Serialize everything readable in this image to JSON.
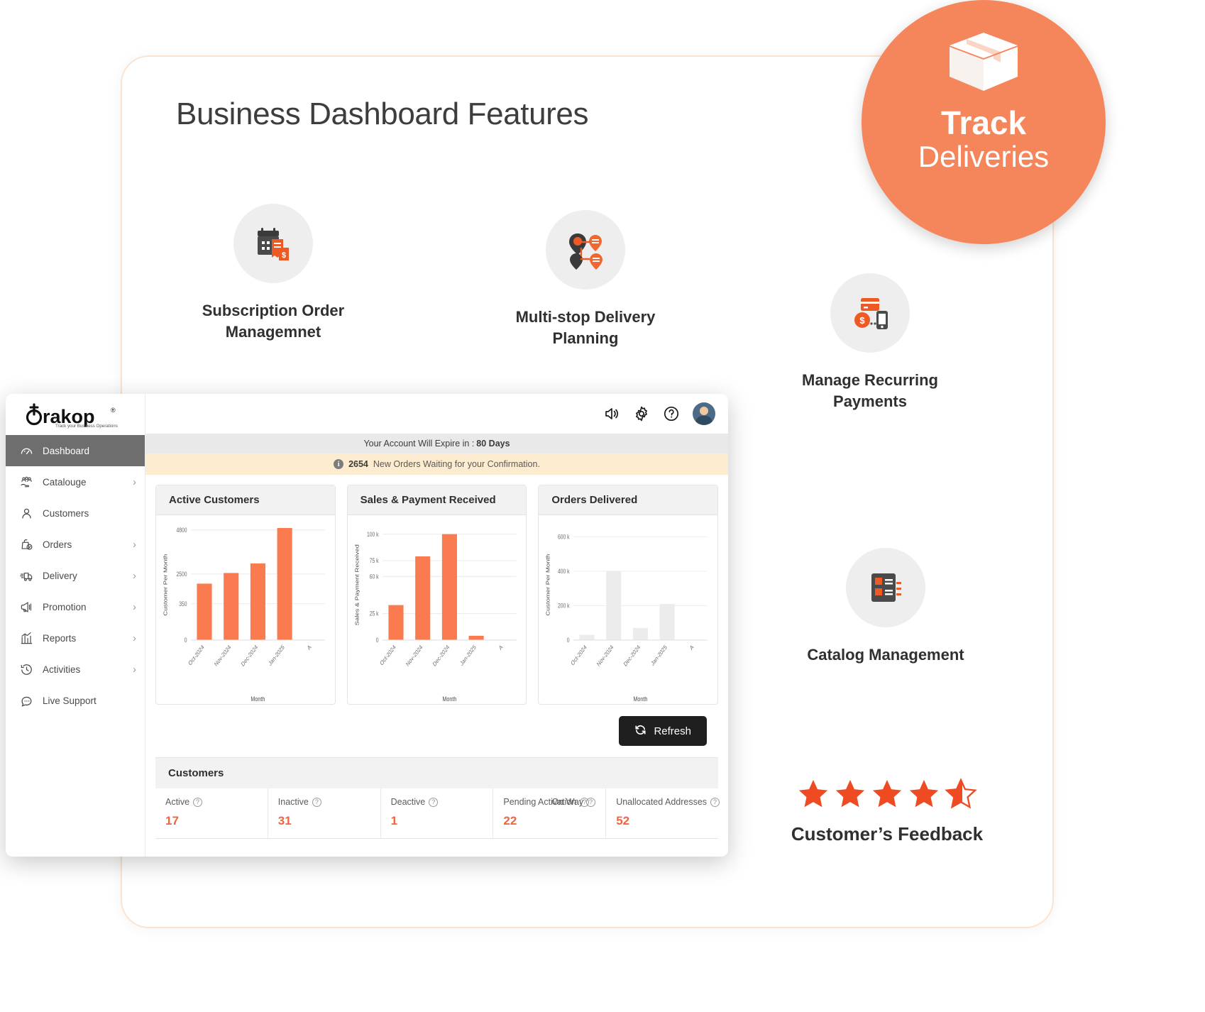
{
  "page": {
    "title": "Business Dashboard Features"
  },
  "badge": {
    "icon": "package-box-icon",
    "line1": "Track",
    "line2": "Deliveries",
    "color": "#f5855a"
  },
  "features": [
    {
      "icon": "calendar-invoice-icon",
      "label": "Subscription Order Managemnet"
    },
    {
      "icon": "route-map-pin-icon",
      "label": "Multi-stop Delivery Planning"
    },
    {
      "icon": "recurring-payment-icon",
      "label": "Manage Recurring Payments"
    },
    {
      "icon": "catalog-list-icon",
      "label": "Catalog Management"
    }
  ],
  "feedback": {
    "label": "Customer’s Feedback",
    "rating": 4.5,
    "star_count": 5,
    "star_color": "#ef4b23"
  },
  "dashboard": {
    "brand": {
      "name": "trakop",
      "registered": "®",
      "tagline": "Track your Business Operations"
    },
    "sidebar": {
      "items": [
        {
          "label": "Dashboard",
          "icon": "gauge-icon",
          "active": true,
          "chevron": false
        },
        {
          "label": "Catalouge",
          "icon": "catalogue-icon",
          "active": false,
          "chevron": true
        },
        {
          "label": "Customers",
          "icon": "user-icon",
          "active": false,
          "chevron": false
        },
        {
          "label": "Orders",
          "icon": "bag-check-icon",
          "active": false,
          "chevron": true
        },
        {
          "label": "Delivery",
          "icon": "truck-icon",
          "active": false,
          "chevron": true
        },
        {
          "label": "Promotion",
          "icon": "megaphone-icon",
          "active": false,
          "chevron": true
        },
        {
          "label": "Reports",
          "icon": "bar-chart-icon",
          "active": false,
          "chevron": true
        },
        {
          "label": "Activities",
          "icon": "history-icon",
          "active": false,
          "chevron": true
        },
        {
          "label": "Live Support",
          "icon": "chat-icon",
          "active": false,
          "chevron": false
        }
      ]
    },
    "topbar": {
      "icons": [
        "speaker-icon",
        "gear-icon",
        "help-icon"
      ],
      "avatar": "user-avatar"
    },
    "expiry_bar": {
      "text": "Your Account Will Expire in :",
      "value": "80 Days"
    },
    "orders_bar": {
      "icon": "info-icon",
      "count": "2654",
      "text": "New Orders Waiting for your Confirmation."
    },
    "refresh_button": {
      "label": "Refresh",
      "icon": "refresh-icon"
    },
    "customers_panel": {
      "title": "Customers",
      "stats": [
        {
          "label": "Active",
          "value": "17",
          "help": true
        },
        {
          "label": "Inactive",
          "value": "31",
          "help": true
        },
        {
          "label": "Deactive",
          "value": "1",
          "help": true
        },
        {
          "label": "Pending Activation",
          "value": "22",
          "help": true,
          "extra_label": "On Way",
          "extra_help": true
        },
        {
          "label": "Unallocated Addresses",
          "value": "52",
          "help": true
        }
      ]
    }
  },
  "chart_data": [
    {
      "type": "bar",
      "title": "Active Customers",
      "xlabel": "Month",
      "ylabel": "Customer Per Month",
      "categories": [
        "Oct-2024",
        "Nov-2024",
        "Dec-2024",
        "Jan-2025",
        "A"
      ],
      "values": [
        1800,
        2550,
        3050,
        4900,
        0
      ],
      "ytick_labels": [
        "0",
        "350",
        "2500",
        "4800"
      ],
      "ytick_values": [
        0,
        350,
        2500,
        4800
      ],
      "ylim": [
        0,
        5100
      ],
      "bar_color": "#f97b4f",
      "grid": true,
      "legend": "none"
    },
    {
      "type": "bar",
      "title": "Sales & Payment Received",
      "xlabel": "Month",
      "ylabel": "Sales & Payment Received",
      "categories": [
        "Oct-2024",
        "Nov-2024",
        "Dec-2024",
        "Jan-2025",
        "A"
      ],
      "values": [
        33000,
        79000,
        100000,
        4000,
        0
      ],
      "ytick_labels": [
        "0",
        "25 k",
        "60 k",
        "75 k",
        "100 k"
      ],
      "ytick_values": [
        0,
        25000,
        60000,
        75000,
        100000
      ],
      "ylim": [
        0,
        104000
      ],
      "bar_color": "#f97b4f",
      "grid": true,
      "legend": "none"
    },
    {
      "type": "bar",
      "title": "Orders Delivered",
      "xlabel": "Month",
      "ylabel": "Customer Per Month",
      "categories": [
        "Oct-2024",
        "Nov-2024",
        "Dec-2024",
        "Jan-2025",
        "A"
      ],
      "values": [
        30000,
        400000,
        70000,
        210000,
        0
      ],
      "ytick_labels": [
        "0",
        "200 k",
        "400 k",
        "600 k"
      ],
      "ytick_values": [
        0,
        200000,
        400000,
        600000
      ],
      "ylim": [
        0,
        640000
      ],
      "bar_color": "#ececec",
      "grid": true,
      "legend": "none"
    }
  ]
}
